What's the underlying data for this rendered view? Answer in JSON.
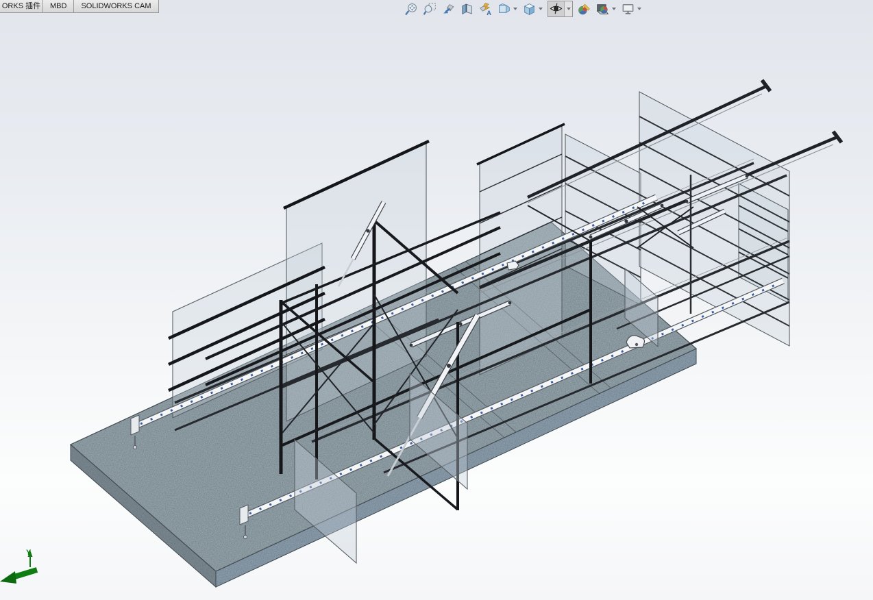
{
  "command_manager": {
    "tabs": [
      {
        "label": "ORKS 插件"
      },
      {
        "label": "MBD"
      },
      {
        "label": "SOLIDWORKS CAM"
      }
    ]
  },
  "heads_up_toolbar": {
    "items": [
      {
        "name": "zoom-to-fit",
        "has_dropdown": false,
        "pressed": false
      },
      {
        "name": "zoom-to-area",
        "has_dropdown": false,
        "pressed": false
      },
      {
        "name": "previous-view",
        "has_dropdown": false,
        "pressed": false
      },
      {
        "name": "section-view",
        "has_dropdown": false,
        "pressed": false
      },
      {
        "name": "dynamic-annotation-views",
        "has_dropdown": false,
        "pressed": false
      },
      {
        "name": "view-orientation",
        "has_dropdown": true,
        "pressed": false
      },
      {
        "name": "display-style",
        "has_dropdown": true,
        "pressed": false
      },
      {
        "name": "hide-show-items",
        "has_dropdown": true,
        "pressed": true
      },
      {
        "name": "edit-appearance",
        "has_dropdown": false,
        "pressed": false
      },
      {
        "name": "apply-scene",
        "has_dropdown": true,
        "pressed": false
      },
      {
        "name": "view-settings",
        "has_dropdown": true,
        "pressed": false
      }
    ]
  },
  "viewport": {
    "triad": {
      "label": "Y",
      "color": "#0f7d12"
    },
    "model_description": "Isometric view of a steel rail-and-panel frame structure mounted on a segmented concrete slab"
  },
  "colors": {
    "background_top": "#e2e6ec",
    "background_bottom": "#fcfdfd",
    "slab_top": "#92a0a8",
    "slab_side_left": "#7b8891",
    "slab_side_right": "#8a9cab",
    "steel_dark": "#1b1d20",
    "steel_white": "#f2f4f7",
    "perforation_blue": "#3a5fa8",
    "tab_fill": "#d9d9d9"
  }
}
